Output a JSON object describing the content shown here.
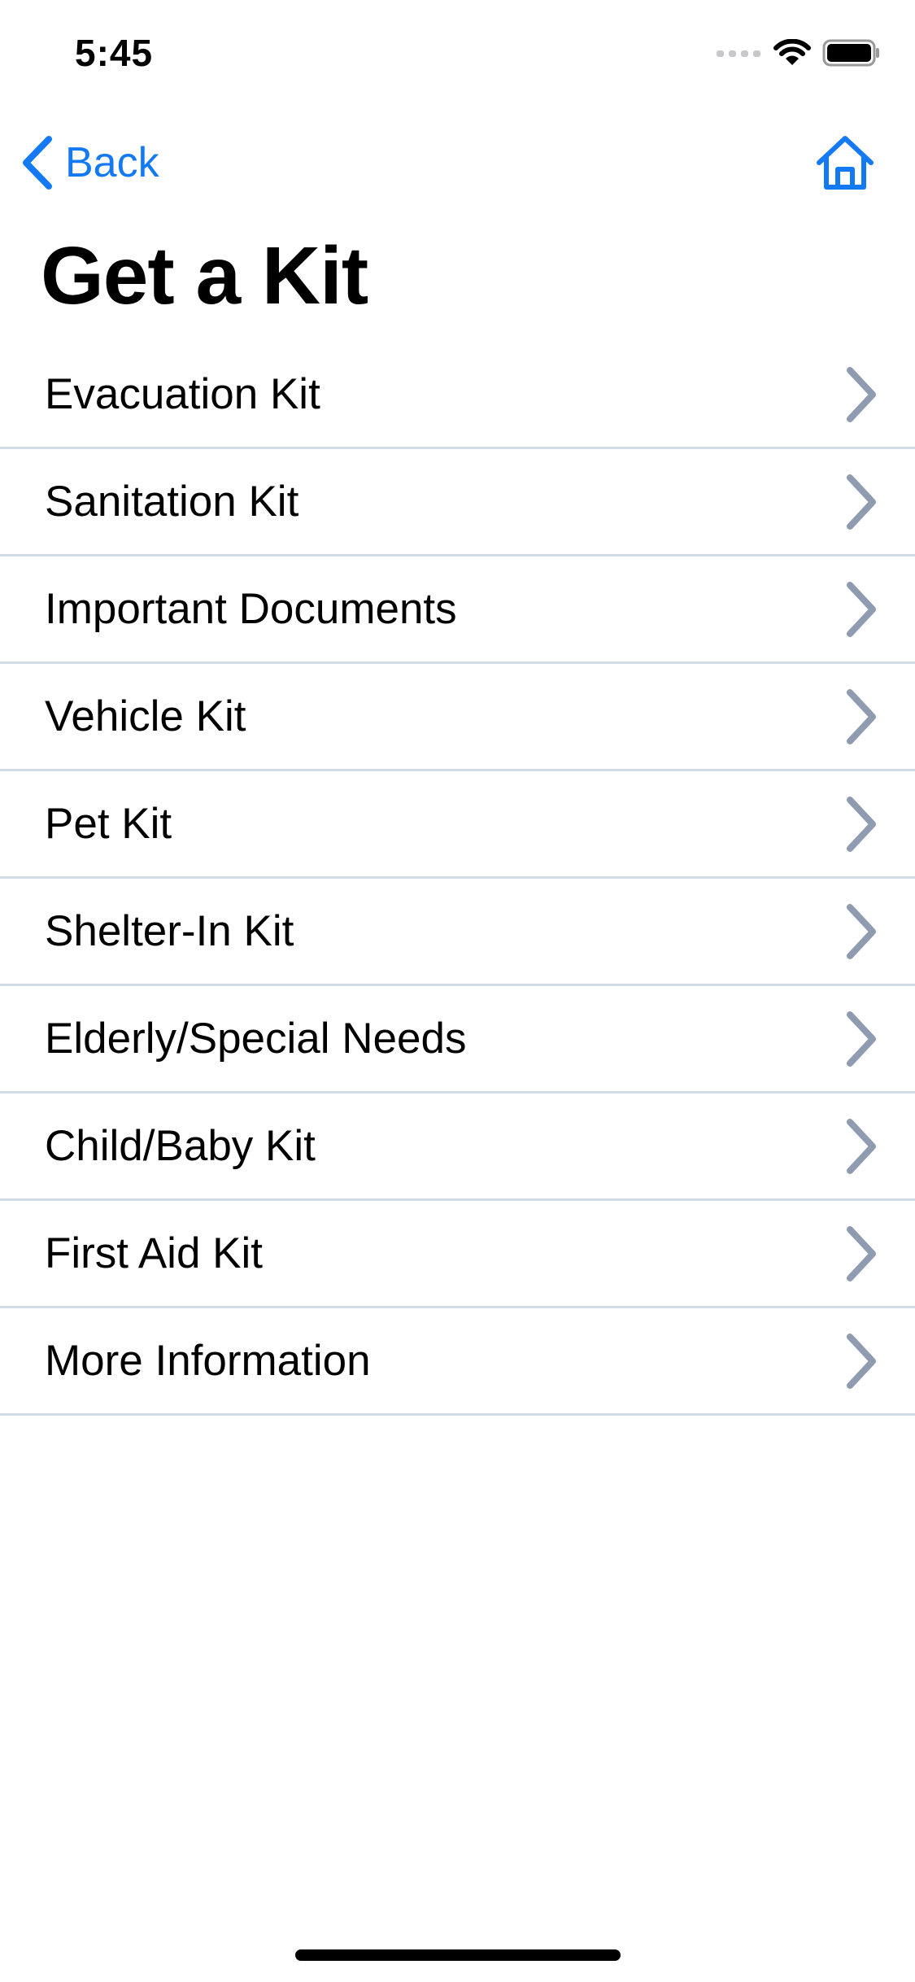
{
  "status_bar": {
    "time": "5:45"
  },
  "nav": {
    "back_label": "Back",
    "back_icon": "chevron-left-icon",
    "home_icon": "home-icon"
  },
  "page": {
    "title": "Get a Kit"
  },
  "kits": [
    {
      "label": "Evacuation Kit"
    },
    {
      "label": "Sanitation Kit"
    },
    {
      "label": "Important Documents"
    },
    {
      "label": "Vehicle Kit"
    },
    {
      "label": "Pet Kit"
    },
    {
      "label": "Shelter-In Kit"
    },
    {
      "label": "Elderly/Special Needs"
    },
    {
      "label": "Child/Baby Kit"
    },
    {
      "label": "First Aid Kit"
    },
    {
      "label": "More Information"
    }
  ],
  "colors": {
    "accent": "#1479F5",
    "chevron": "#8E9BB0",
    "divider": "#D3DBE6",
    "text": "#000000",
    "background": "#FFFFFF"
  }
}
